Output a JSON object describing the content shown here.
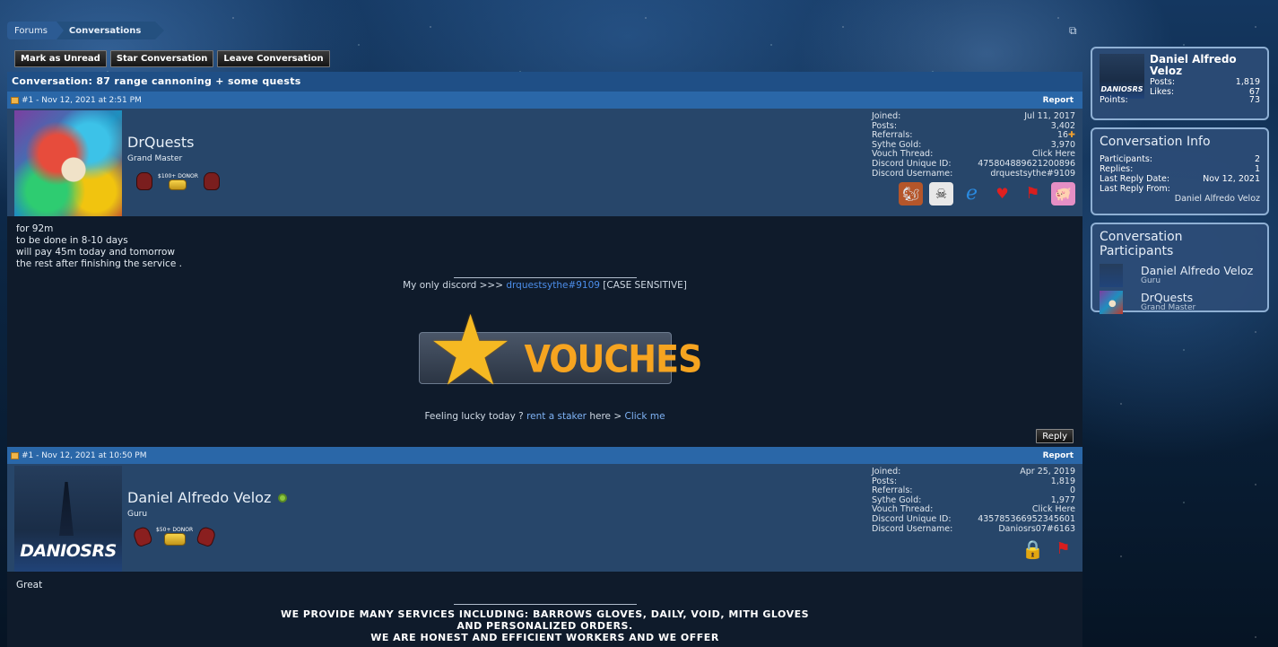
{
  "breadcrumb": {
    "forums": "Forums",
    "conversations": "Conversations"
  },
  "actions": {
    "mark_unread": "Mark as Unread",
    "star": "Star Conversation",
    "leave": "Leave Conversation"
  },
  "conversation_title": "Conversation: 87 range cannoning + some quests",
  "posts": [
    {
      "header": "#1 - Nov 12, 2021 at 2:51 PM",
      "report": "Report",
      "username": "DrQuests",
      "usertitle": "Grand Master",
      "donor": "$100+ DONOR",
      "stats": [
        {
          "label": "Joined:",
          "value": "Jul 11, 2017"
        },
        {
          "label": "Posts:",
          "value": "3,402"
        },
        {
          "label": "Referrals:",
          "value": "16"
        },
        {
          "label": "Sythe Gold:",
          "value": "3,970"
        },
        {
          "label": "Vouch Thread:",
          "value": "Click Here"
        },
        {
          "label": "Discord Unique ID:",
          "value": "475804889621200896"
        },
        {
          "label": "Discord Username:",
          "value": "drquestsythe#9109"
        }
      ],
      "body": [
        "for 92m",
        "to be done in 8-10 days",
        "will pay 45m today and tomorrow",
        "the rest after finishing the service ."
      ],
      "sig": {
        "discord_prefix": "My only discord >>> ",
        "discord_link": "drquestsythe#9109",
        "discord_suffix": " [CASE SENSITIVE]",
        "vouches": "VOUCHES",
        "lucky_prefix": "Feeling lucky today ? ",
        "lucky_link": "rent a staker",
        "lucky_mid": " here > ",
        "lucky_link2": "Click me"
      },
      "reply": "Reply"
    },
    {
      "header": "#1 - Nov 12, 2021 at 10:50 PM",
      "report": "Report",
      "username": "Daniel Alfredo Veloz",
      "usertitle": "Guru",
      "donor": "$50+ DONOR",
      "avatar_text": "DANIOSRS",
      "stats": [
        {
          "label": "Joined:",
          "value": "Apr 25, 2019"
        },
        {
          "label": "Posts:",
          "value": "1,819"
        },
        {
          "label": "Referrals:",
          "value": "0"
        },
        {
          "label": "Sythe Gold:",
          "value": "1,977"
        },
        {
          "label": "Vouch Thread:",
          "value": "Click Here"
        },
        {
          "label": "Discord Unique ID:",
          "value": "435785366952345601"
        },
        {
          "label": "Discord Username:",
          "value": "Daniosrs07#6163"
        }
      ],
      "body": [
        "Great"
      ],
      "services": [
        "WE PROVIDE MANY SERVICES INCLUDING: BARROWS GLOVES, DAILY, VOID, MITH GLOVES",
        "AND PERSONALIZED ORDERS.",
        "WE ARE HONEST AND EFFICIENT WORKERS AND WE OFFER"
      ]
    }
  ],
  "sidebar": {
    "me": {
      "name": "Daniel Alfredo Veloz",
      "avatar_text": "DANIOSRS",
      "posts_label": "Posts:",
      "posts": "1,819",
      "likes_label": "Likes:",
      "likes": "67",
      "points_label": "Points:",
      "points": "73"
    },
    "info": {
      "title": "Conversation Info",
      "participants_label": "Participants:",
      "participants": "2",
      "replies_label": "Replies:",
      "replies": "1",
      "last_reply_date_label": "Last Reply Date:",
      "last_reply_date": "Nov 12, 2021",
      "last_reply_from_label": "Last Reply From:",
      "last_reply_from": "Daniel Alfredo Veloz"
    },
    "participants": {
      "title": "Conversation Participants",
      "list": [
        {
          "name": "Daniel Alfredo Veloz",
          "title": "Guru"
        },
        {
          "name": "DrQuests",
          "title": "Grand Master"
        }
      ]
    }
  }
}
